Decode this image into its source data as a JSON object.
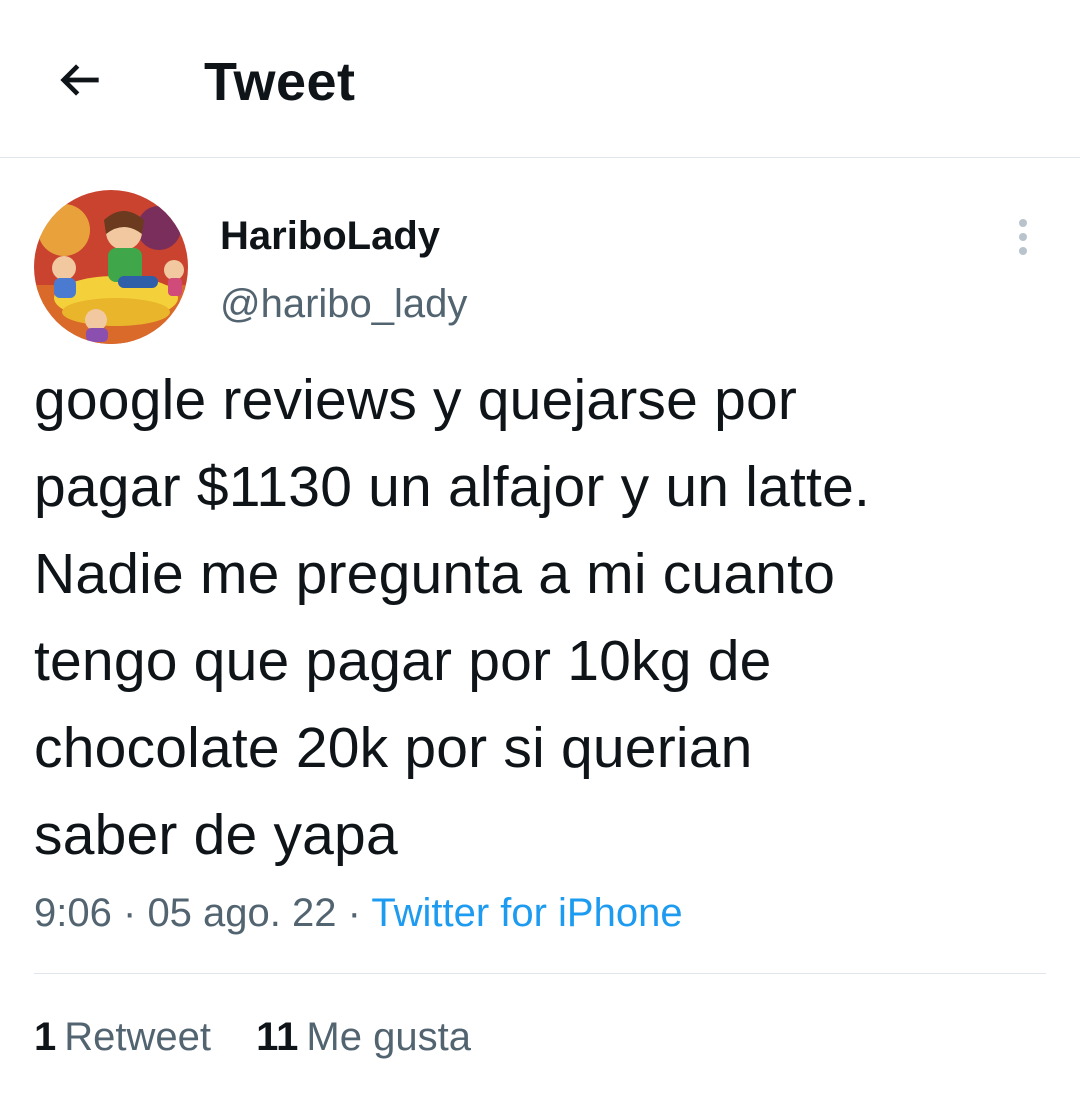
{
  "header": {
    "title": "Tweet",
    "back_icon": "arrow-left-icon"
  },
  "author": {
    "display_name": "HariboLady",
    "handle": "@haribo_lady",
    "avatar_icon": "user-avatar-illustration"
  },
  "tweet": {
    "text": "google reviews y quejarse por\npagar $1130 un alfajor y un latte.\nNadie me pregunta a mi cuanto\ntengo que pagar por 10kg de\nchocolate 20k por si querian\nsaber de yapa",
    "time": "9:06",
    "date": "05 ago. 22",
    "separator": "·",
    "source": "Twitter for iPhone",
    "more_icon": "more-vertical-icon"
  },
  "stats": {
    "retweets_count": "1",
    "retweets_label": "Retweet",
    "likes_count": "11",
    "likes_label": "Me gusta"
  },
  "colors": {
    "text_primary": "#0f1419",
    "text_secondary": "#536471",
    "link": "#1d9bf0",
    "divider": "#dfe5ea"
  }
}
